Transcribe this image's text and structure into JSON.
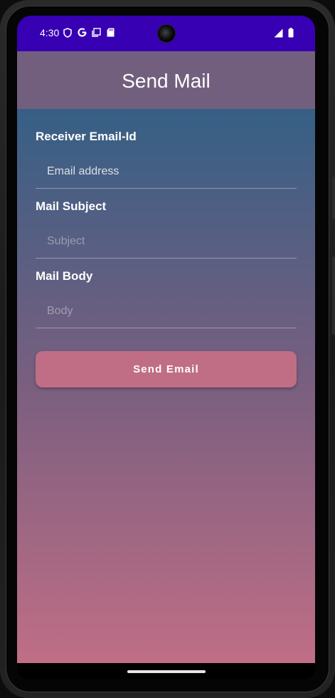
{
  "status_bar": {
    "time": "4:30",
    "left_icons": [
      "shield-icon",
      "google-icon",
      "screenshot-icon",
      "sd-card-icon"
    ],
    "right_icons": [
      "signal-icon",
      "battery-icon"
    ],
    "color": "#3700b3"
  },
  "app_bar": {
    "title": "Send Mail",
    "color": "#725f7e"
  },
  "form": {
    "receiver": {
      "label": "Receiver Email-Id",
      "placeholder": "Email address"
    },
    "subject": {
      "label": "Mail Subject",
      "placeholder": "Subject"
    },
    "body": {
      "label": "Mail Body",
      "placeholder": "Body"
    },
    "send_button_label": "Send Email",
    "button_color": "#c06e86",
    "gradient_top": "#365f85",
    "gradient_bottom": "#c06e86"
  }
}
